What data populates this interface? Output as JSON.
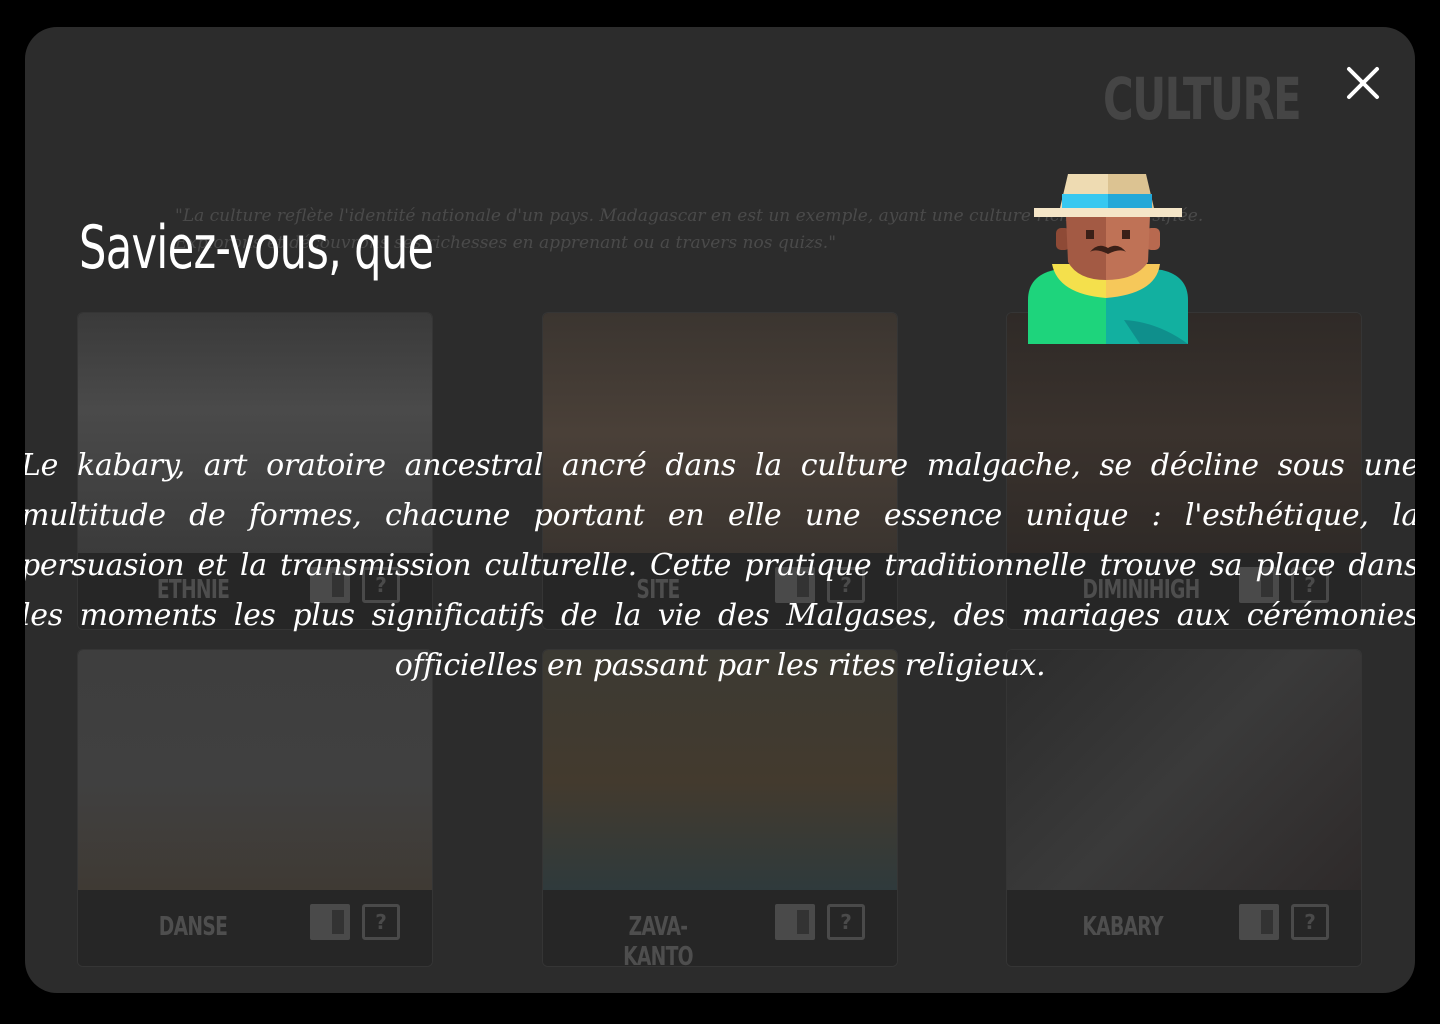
{
  "background_page": {
    "title": "CULTURE",
    "intro": "\"La culture reflète l'identité nationale d'un pays. Madagascar en est un exemple, ayant une culture riche et diversifiée. Explorons et découvrons ses richesses en apprenant ou a travers nos quizs.\"",
    "cards": [
      {
        "label": "ETHNIE"
      },
      {
        "label": "SITE"
      },
      {
        "label": "DIMINIHIGH"
      },
      {
        "label": "DANSE"
      },
      {
        "label": "ZAVA-KANTO"
      },
      {
        "label": "KABARY"
      }
    ]
  },
  "modal": {
    "close_icon": "close-icon",
    "heading": "Saviez-vous, que",
    "mascot_icon": "malagasy-man-with-hat-icon",
    "fact": "Le kabary, art oratoire ancestral ancré dans la culture malgache, se décline sous une multitude de formes, chacune portant en elle une essence unique : l'esthétique, la persuasion et la transmission culturelle. Cette pratique traditionnelle trouve sa place dans les moments les plus significatifs de la vie des Malgases, des mariages aux cérémonies officielles en passant par les rites religieux."
  },
  "colors": {
    "overlay_panel": "#2c2c2c",
    "text": "#ffffff",
    "hat_band": "#38c8f0",
    "scarf": "#f4e04c",
    "shirt": "#1ed47c"
  }
}
